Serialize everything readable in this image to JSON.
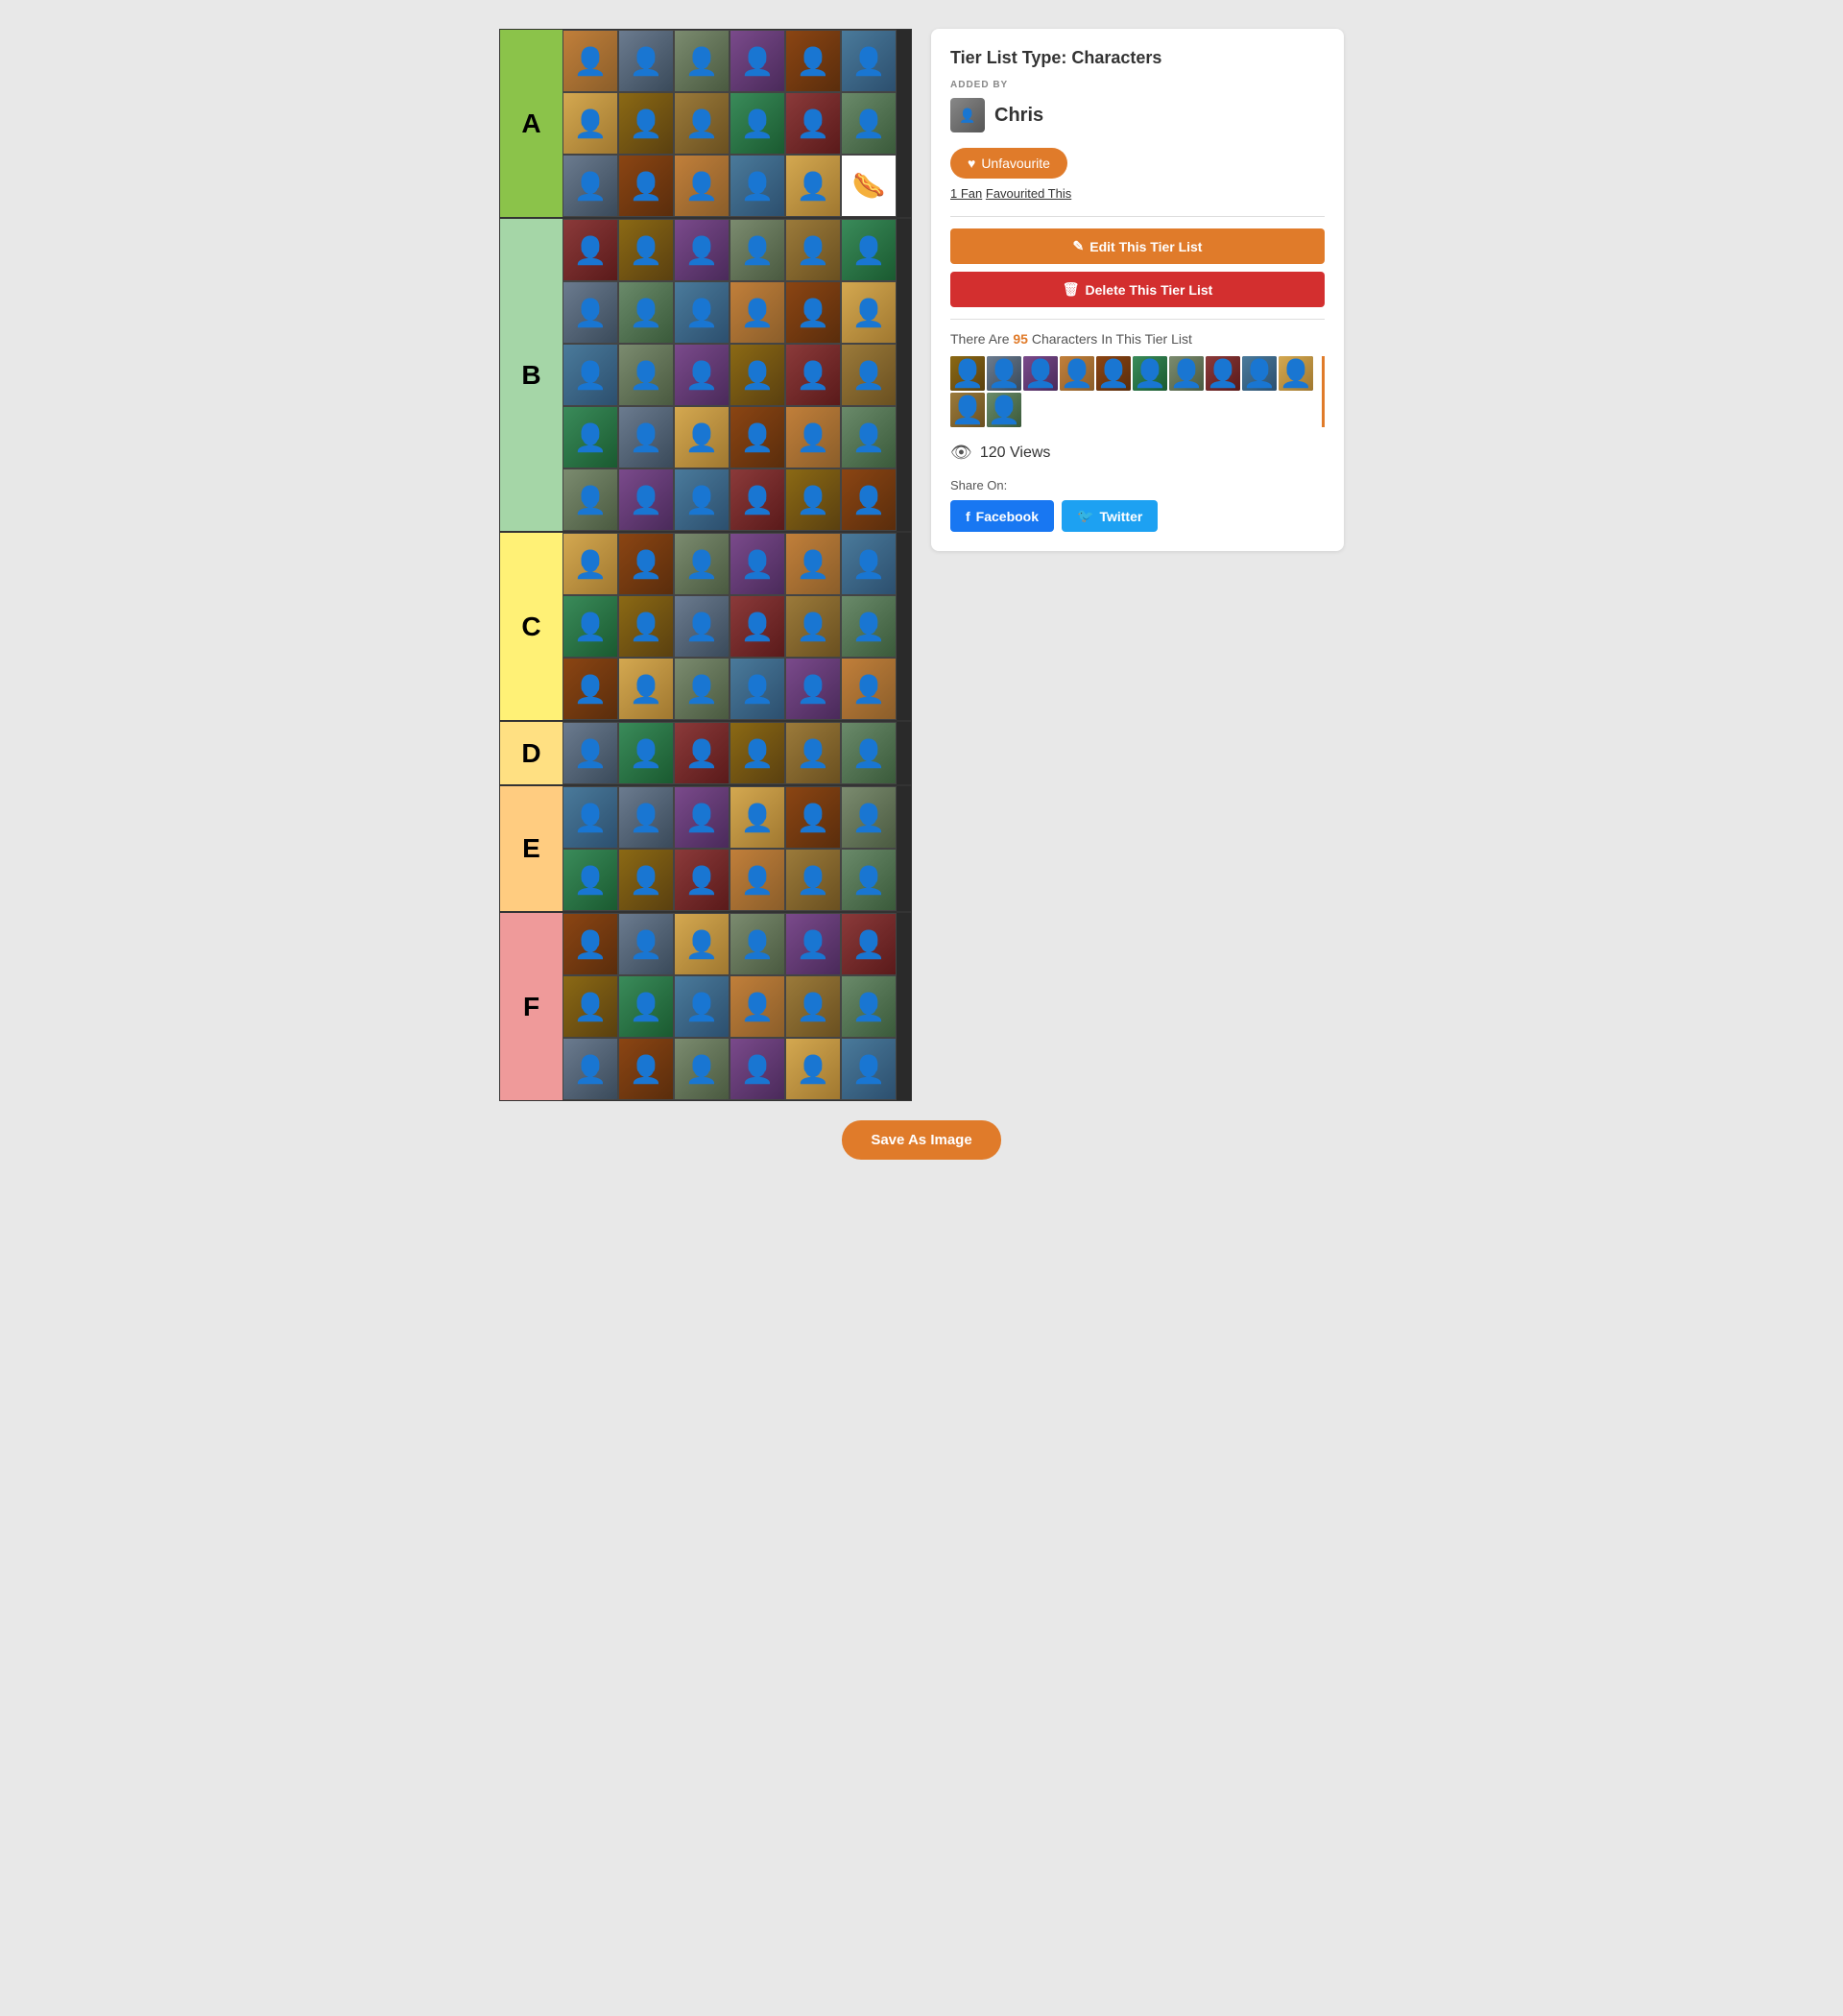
{
  "page": {
    "title": "Tier List Type: Characters",
    "added_by": "ADDED BY",
    "author": {
      "name": "Chris",
      "avatar_icon": "👤"
    },
    "unfav_button": "Unfavourite",
    "fav_count": "1 Fan",
    "fav_text": "Favourited This",
    "edit_button": "Edit This Tier List",
    "delete_button": "Delete This Tier List",
    "chars_count_pre": "There Are ",
    "chars_count_num": "95",
    "chars_count_post": " Characters In This Tier List",
    "views": "120 Views",
    "share_label": "Share On:",
    "facebook_btn": "Facebook",
    "twitter_btn": "Twitter",
    "save_image_btn": "Save As Image"
  },
  "tiers": [
    {
      "label": "A",
      "color_class": "tier-a",
      "rows": 3,
      "count": 18
    },
    {
      "label": "B",
      "color_class": "tier-b",
      "rows": 5,
      "count": 30
    },
    {
      "label": "C",
      "color_class": "tier-c",
      "rows": 3,
      "count": 18
    },
    {
      "label": "D",
      "color_class": "tier-d",
      "rows": 1,
      "count": 6
    },
    {
      "label": "E",
      "color_class": "tier-e",
      "rows": 2,
      "count": 12
    },
    {
      "label": "F",
      "color_class": "tier-f",
      "rows": 3,
      "count": 18
    }
  ],
  "face_colors": [
    "fc1",
    "fc2",
    "fc3",
    "fc4",
    "fc5",
    "fc6",
    "fc7",
    "fc8",
    "fc9",
    "fc10",
    "fc11",
    "fc12"
  ]
}
